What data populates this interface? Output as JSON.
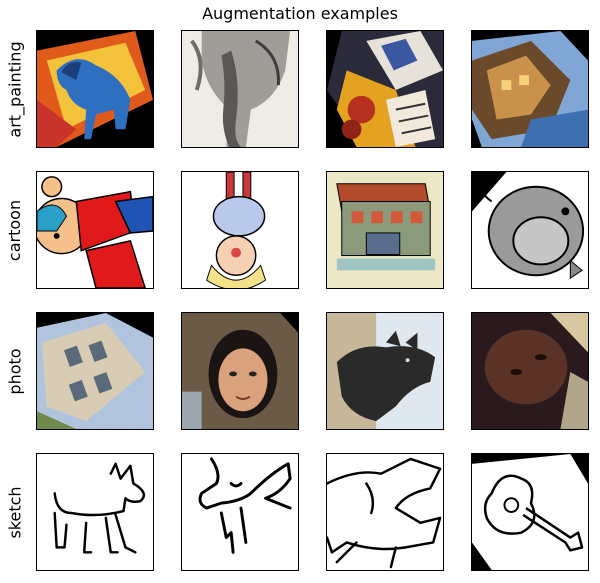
{
  "title": "Augmentation examples",
  "rows": [
    {
      "label": "art_painting"
    },
    {
      "label": "cartoon"
    },
    {
      "label": "photo"
    },
    {
      "label": "sketch"
    }
  ]
}
